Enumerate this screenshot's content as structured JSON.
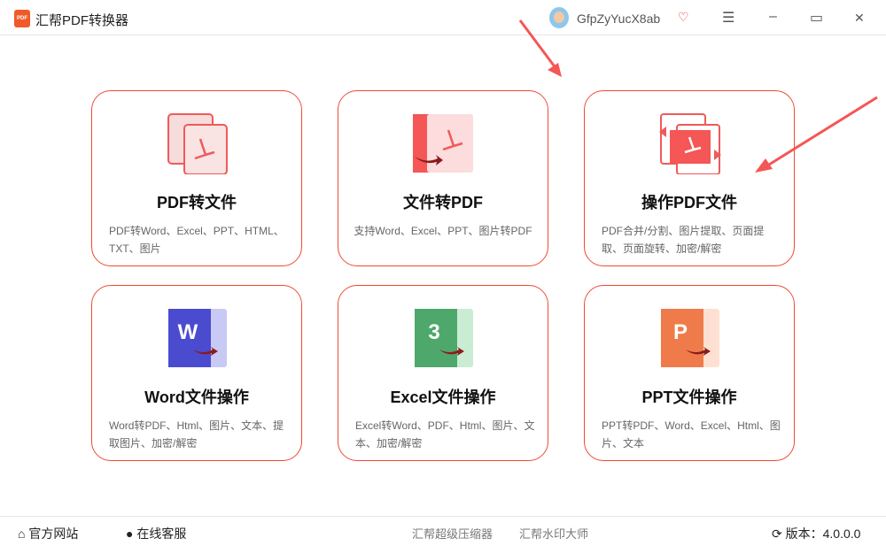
{
  "header": {
    "app_title": "汇帮PDF转换器",
    "logo_text": "PDF",
    "username": "GfpZyYucX8ab"
  },
  "cards": [
    {
      "title": "PDF转文件",
      "desc": "PDF转Word、Excel、PPT、HTML、TXT、图片"
    },
    {
      "title": "文件转PDF",
      "desc": "支持Word、Excel、PPT、图片转PDF"
    },
    {
      "title": "操作PDF文件",
      "desc": "PDF合并/分割、图片提取、页面提取、页面旋转、加密/解密"
    },
    {
      "title": "Word文件操作",
      "desc": "Word转PDF、Html、图片、文本、提取图片、加密/解密"
    },
    {
      "title": "Excel文件操作",
      "desc": "Excel转Word、PDF、Html、图片、文本、加密/解密"
    },
    {
      "title": "PPT文件操作",
      "desc": "PPT转PDF、Word、Excel、Html、图片、文本"
    }
  ],
  "footer": {
    "website": "官方网站",
    "support": "在线客服",
    "link1": "汇帮超级压缩器",
    "link2": "汇帮水印大师",
    "version": "版本：4.0.0.0"
  },
  "colors": {
    "accent": "#ee4a35",
    "word": "#4b4bcf",
    "excel": "#4fa86b",
    "ppt": "#f07b4a"
  }
}
